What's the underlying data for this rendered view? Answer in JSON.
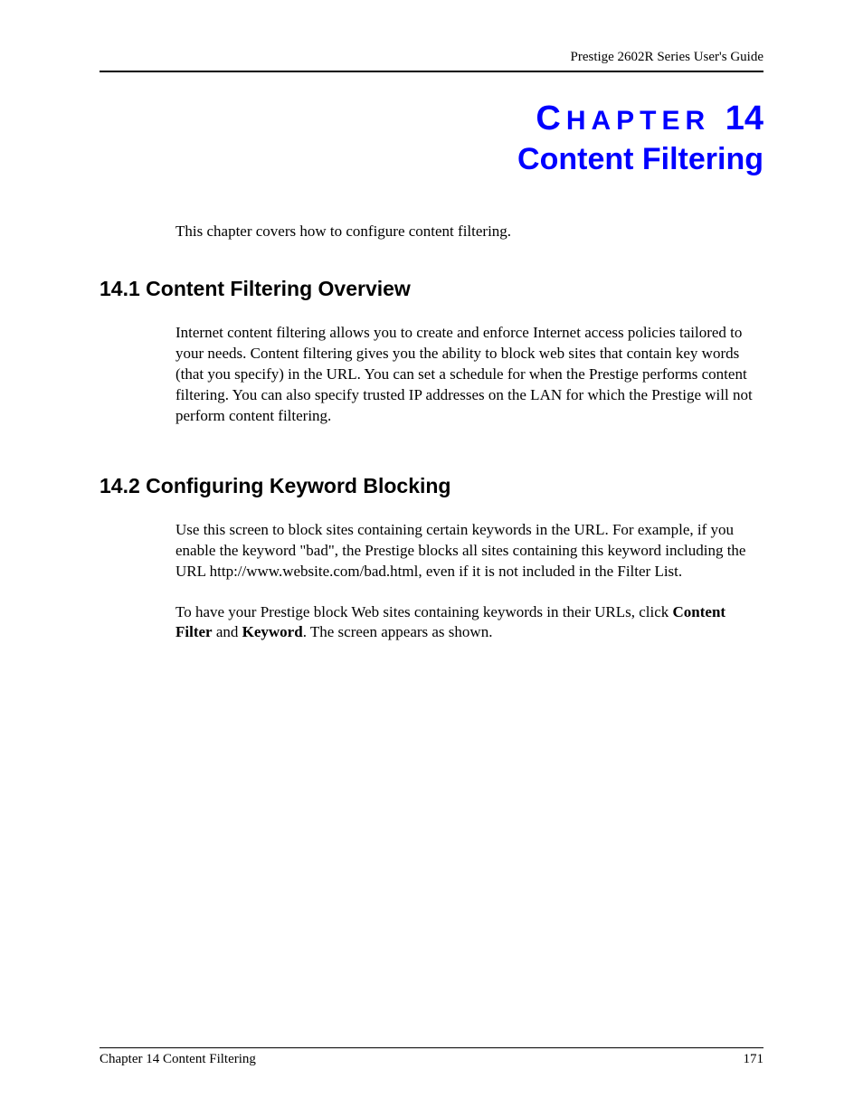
{
  "header": {
    "guide_title": "Prestige 2602R Series User's Guide"
  },
  "chapter": {
    "label_small": "HAPTER",
    "label_first": "C",
    "number": "14",
    "title": "Content Filtering"
  },
  "intro": "This chapter covers how to configure content filtering.",
  "sections": [
    {
      "heading": "14.1  Content Filtering Overview",
      "paragraphs": [
        "Internet content filtering allows you to create and enforce Internet access policies tailored to your needs. Content filtering gives you the ability to block web sites that contain key words (that you specify) in the URL. You can set a schedule for when the Prestige performs content filtering. You can also specify trusted IP addresses on the LAN for which the Prestige will not perform content filtering."
      ]
    },
    {
      "heading": "14.2  Configuring Keyword Blocking",
      "paragraphs": [
        "Use this screen to block sites containing certain keywords in the URL. For example, if you enable the keyword \"bad\", the Prestige blocks all sites containing this keyword including the URL http://www.website.com/bad.html, even if it is not included in the Filter List.",
        "__RICH_P2__"
      ]
    }
  ],
  "rich_p2": {
    "pre": "To have your Prestige block Web sites containing keywords in their URLs, click ",
    "bold1": "Content Filter",
    "mid": " and ",
    "bold2": "Keyword",
    "post": ". The screen appears as shown."
  },
  "footer": {
    "left": "Chapter 14 Content Filtering",
    "right": "171"
  }
}
